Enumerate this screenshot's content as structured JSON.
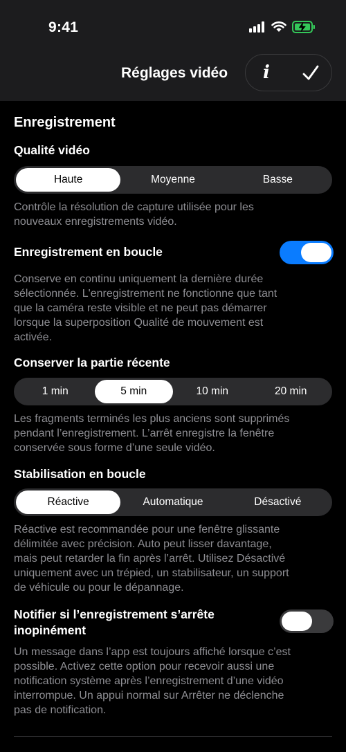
{
  "status_bar": {
    "time": "9:41"
  },
  "header": {
    "title": "Réglages vidéo",
    "info_label": "i"
  },
  "section": {
    "title": "Enregistrement"
  },
  "video_quality": {
    "label": "Qualité vidéo",
    "options": [
      "Haute",
      "Moyenne",
      "Basse"
    ],
    "selected": "Haute",
    "description": "Contrôle la résolution de capture utilisée pour les\nnouveaux enregistrements vidéo."
  },
  "loop_recording": {
    "label": "Enregistrement en boucle",
    "enabled": true,
    "description": "Conserve en continu uniquement la dernière durée\nsélectionnée. L'enregistrement ne fonctionne que tant\nque la caméra reste visible et ne peut pas démarrer\nlorsque la superposition Qualité de mouvement est\nactivée."
  },
  "keep_recent": {
    "label": "Conserver la partie récente",
    "options": [
      "1 min",
      "5 min",
      "10 min",
      "20 min"
    ],
    "selected": "5 min",
    "description": "Les fragments terminés les plus anciens sont supprimés\npendant l’enregistrement. L’arrêt enregistre la fenêtre\nconservée sous forme d’une seule vidéo."
  },
  "loop_stabilization": {
    "label": "Stabilisation en boucle",
    "options": [
      "Réactive",
      "Automatique",
      "Désactivé"
    ],
    "selected": "Réactive",
    "description": "Réactive est recommandée pour une fenêtre glissante\ndélimitée avec précision. Auto peut lisser davantage,\nmais peut retarder la fin après l’arrêt. Utilisez Désactivé\nuniquement avec un trépied, un stabilisateur, un support\nde véhicule ou pour le dépannage."
  },
  "notify_stop": {
    "label": "Notifier si l’enregistrement s’arrête\ninopinément",
    "enabled": false,
    "description": "Un message dans l’app est toujours affiché lorsque c’est\npossible. Activez cette option pour recevoir aussi une\nnotification système après l’enregistrement d’une vidéo\ninterrompue. Un appui normal sur Arrêter ne déclenche\npas de notification."
  },
  "colors": {
    "accent": "#0a7cff",
    "battery": "#34c759",
    "background": "#000000",
    "header_bg": "#1c1c1e",
    "secondary_text": "#8e8e93"
  },
  "icons": [
    "signal-icon",
    "wifi-icon",
    "battery-charging-icon",
    "info-icon",
    "checkmark-icon"
  ]
}
